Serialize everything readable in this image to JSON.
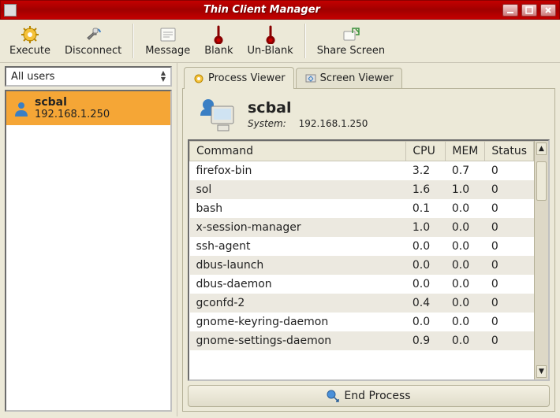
{
  "window": {
    "title": "Thin Client Manager"
  },
  "toolbar": {
    "execute": "Execute",
    "disconnect": "Disconnect",
    "message": "Message",
    "blank": "Blank",
    "unblank": "Un-Blank",
    "share": "Share Screen"
  },
  "sidebar": {
    "filter_value": "All users",
    "users": [
      {
        "name": "scbal",
        "ip": "192.168.1.250",
        "selected": true
      }
    ]
  },
  "tabs": {
    "process": "Process Viewer",
    "screen": "Screen Viewer"
  },
  "client": {
    "name": "scbal",
    "system_label": "System:",
    "system_ip": "192.168.1.250"
  },
  "table": {
    "headers": {
      "command": "Command",
      "cpu": "CPU",
      "mem": "MEM",
      "status": "Status"
    },
    "rows": [
      {
        "command": "firefox-bin",
        "cpu": "3.2",
        "mem": "0.7",
        "status": "0"
      },
      {
        "command": "sol",
        "cpu": "1.6",
        "mem": "1.0",
        "status": "0"
      },
      {
        "command": "bash",
        "cpu": "0.1",
        "mem": "0.0",
        "status": "0"
      },
      {
        "command": "x-session-manager",
        "cpu": "1.0",
        "mem": "0.0",
        "status": "0"
      },
      {
        "command": "ssh-agent",
        "cpu": "0.0",
        "mem": "0.0",
        "status": "0"
      },
      {
        "command": "dbus-launch",
        "cpu": "0.0",
        "mem": "0.0",
        "status": "0"
      },
      {
        "command": "dbus-daemon",
        "cpu": "0.0",
        "mem": "0.0",
        "status": "0"
      },
      {
        "command": "gconfd-2",
        "cpu": "0.4",
        "mem": "0.0",
        "status": "0"
      },
      {
        "command": "gnome-keyring-daemon",
        "cpu": "0.0",
        "mem": "0.0",
        "status": "0"
      },
      {
        "command": "gnome-settings-daemon",
        "cpu": "0.9",
        "mem": "0.0",
        "status": "0"
      }
    ]
  },
  "actions": {
    "end_process": "End Process"
  }
}
